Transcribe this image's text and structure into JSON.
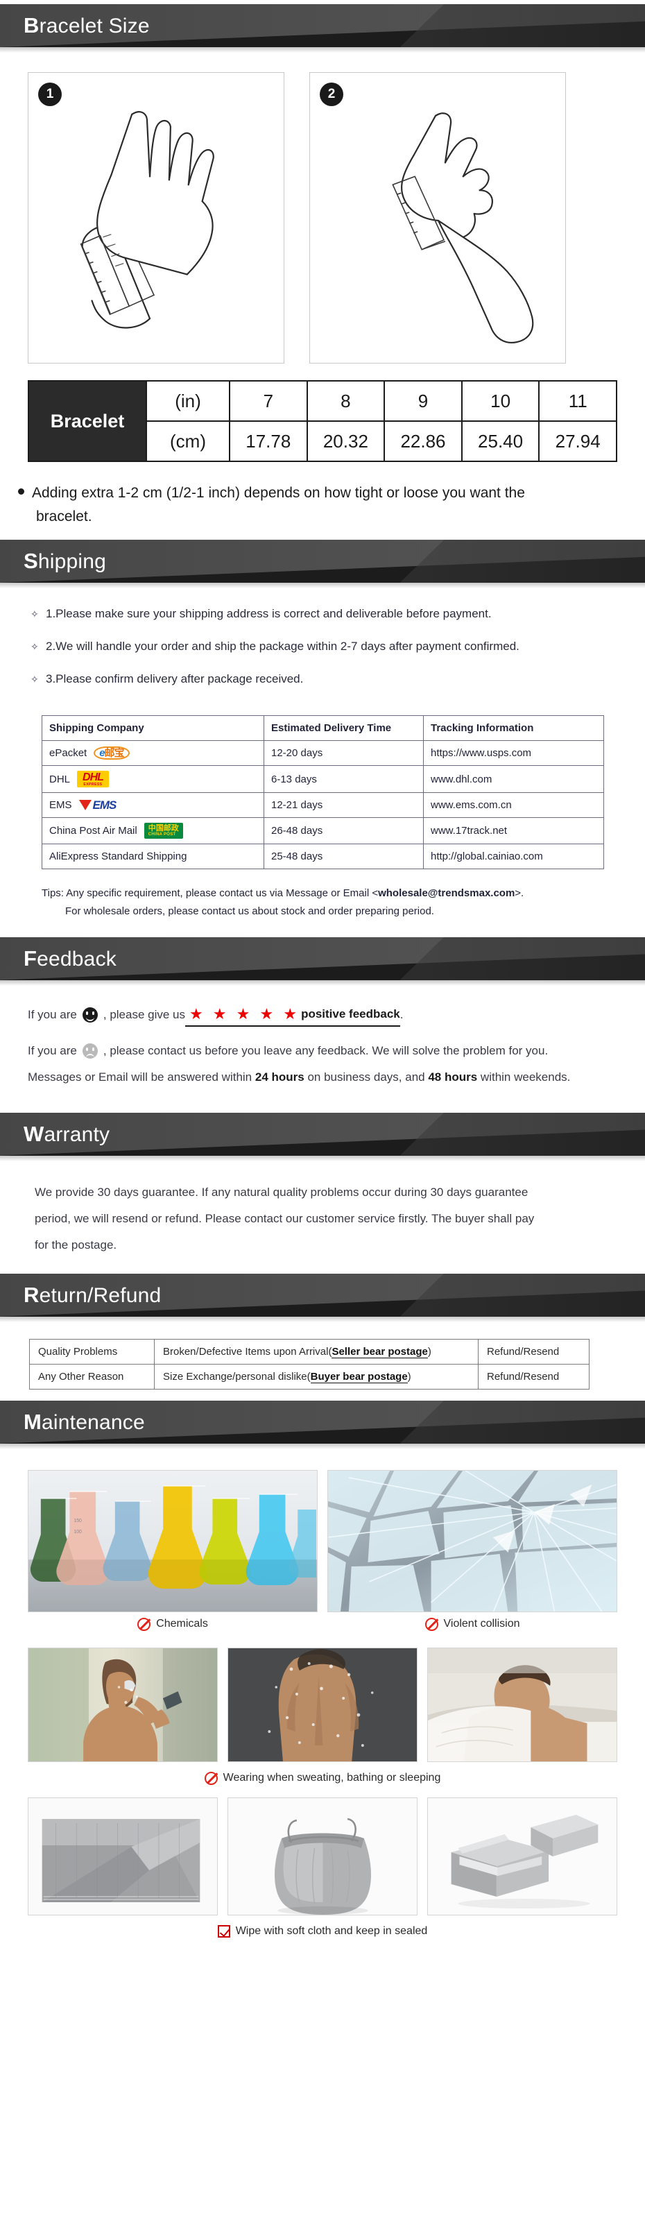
{
  "sections": {
    "bracelet_size": {
      "cap": "B",
      "rest": "racelet Size"
    },
    "shipping": {
      "cap": "S",
      "rest": "hipping"
    },
    "feedback": {
      "cap": "F",
      "rest": "eedback"
    },
    "warranty": {
      "cap": "W",
      "rest": "arranty"
    },
    "return_refund": {
      "cap": "R",
      "rest": "eturn/Refund"
    },
    "maintenance": {
      "cap": "M",
      "rest": "aintenance"
    }
  },
  "bracelet": {
    "step1": "1",
    "step2": "2",
    "row_label": "Bracelet",
    "unit_in": "(in)",
    "unit_cm": "(cm)",
    "inches": [
      "7",
      "8",
      "9",
      "10",
      "11"
    ],
    "cm": [
      "17.78",
      "20.32",
      "22.86",
      "25.40",
      "27.94"
    ],
    "note_line1": "Adding extra 1-2 cm (1/2-1 inch) depends on how tight or loose you want the",
    "note_line2": "bracelet."
  },
  "shipping": {
    "bullets": [
      "1.Please make sure your shipping address is correct and deliverable before payment.",
      "2.We will handle your order and ship the package within 2-7 days after payment confirmed.",
      "3.Please confirm delivery after package received."
    ],
    "bullet_icon": "diamond-bullet-icon",
    "table": {
      "headers": [
        "Shipping Company",
        "Estimated Delivery Time",
        "Tracking Information"
      ],
      "rows": [
        {
          "company": "ePacket",
          "logo": "epacket-logo",
          "time": "12-20 days",
          "tracking": "https://www.usps.com"
        },
        {
          "company": "DHL",
          "logo": "dhl-logo",
          "time": "6-13 days",
          "tracking": "www.dhl.com"
        },
        {
          "company": "EMS",
          "logo": "ems-logo",
          "time": "12-21 days",
          "tracking": "www.ems.com.cn"
        },
        {
          "company": "China Post Air Mail",
          "logo": "china-post-logo",
          "time": "26-48 days",
          "tracking": "www.17track.net"
        },
        {
          "company": "AliExpress Standard Shipping",
          "logo": "",
          "time": "25-48 days",
          "tracking": "http://global.cainiao.com"
        }
      ]
    },
    "tips_prefix": "Tips: Any specific requirement, please contact us via Message or Email <",
    "tips_email": "wholesale@trendsmax.com",
    "tips_suffix": ">.",
    "tips_line2": "For wholesale orders, please contact us about stock and order preparing period."
  },
  "feedback": {
    "positive_pre": "If you are",
    "positive_mid": ", please give us",
    "positive_label": "positive feedback",
    "positive_period": ".",
    "stars": "★ ★ ★ ★ ★",
    "negative_pre": "If you are",
    "negative_mid": ", please contact us before you leave any feedback. We will solve the problem for you.",
    "negative_line2_a": "Messages or Email will be answered within ",
    "negative_bold1": "24 hours",
    "negative_line2_b": " on business days, and ",
    "negative_bold2": "48 hours",
    "negative_line2_c": " within weekends."
  },
  "warranty": {
    "line1": "We provide 30 days guarantee. If any natural quality problems occur during 30 days guarantee",
    "line2": "period, we will resend or refund. Please contact our customer service firstly. The buyer shall pay",
    "line3": "for the postage."
  },
  "return_refund": {
    "rows": [
      {
        "reason": "Quality Problems",
        "desc_a": "Broken/Defective Items upon  Arrival(",
        "desc_b": "Seller bear postage",
        "desc_c": ")",
        "action": "Refund/Resend"
      },
      {
        "reason": "Any Other Reason",
        "desc_a": "Size Exchange/personal dislike(",
        "desc_b": "Buyer bear postage",
        "desc_c": ")",
        "action": "Refund/Resend"
      }
    ]
  },
  "maintenance": {
    "captions": {
      "chemicals": "Chemicals",
      "collision": "Violent collision",
      "sweating": "Wearing when sweating, bathing or sleeping",
      "wipe": "Wipe with soft cloth and keep in sealed"
    },
    "images": {
      "chemicals": "chemistry-flasks-image",
      "collision": "shattered-glass-image",
      "sweating_a": "man-drinking-water-image",
      "sweating_b": "man-shower-back-image",
      "sweating_c": "man-sleeping-image",
      "wipe_a": "gray-microfiber-cloth-image",
      "wipe_b": "gray-drawstring-pouch-image",
      "wipe_c": "gray-jewelry-box-image"
    }
  },
  "colors": {
    "banner_dark": "#1c1c1c",
    "banner_gray": "#545454",
    "star_red": "#ee0000",
    "prohibit_red": "#e2231a",
    "check_red": "#cc0000"
  }
}
